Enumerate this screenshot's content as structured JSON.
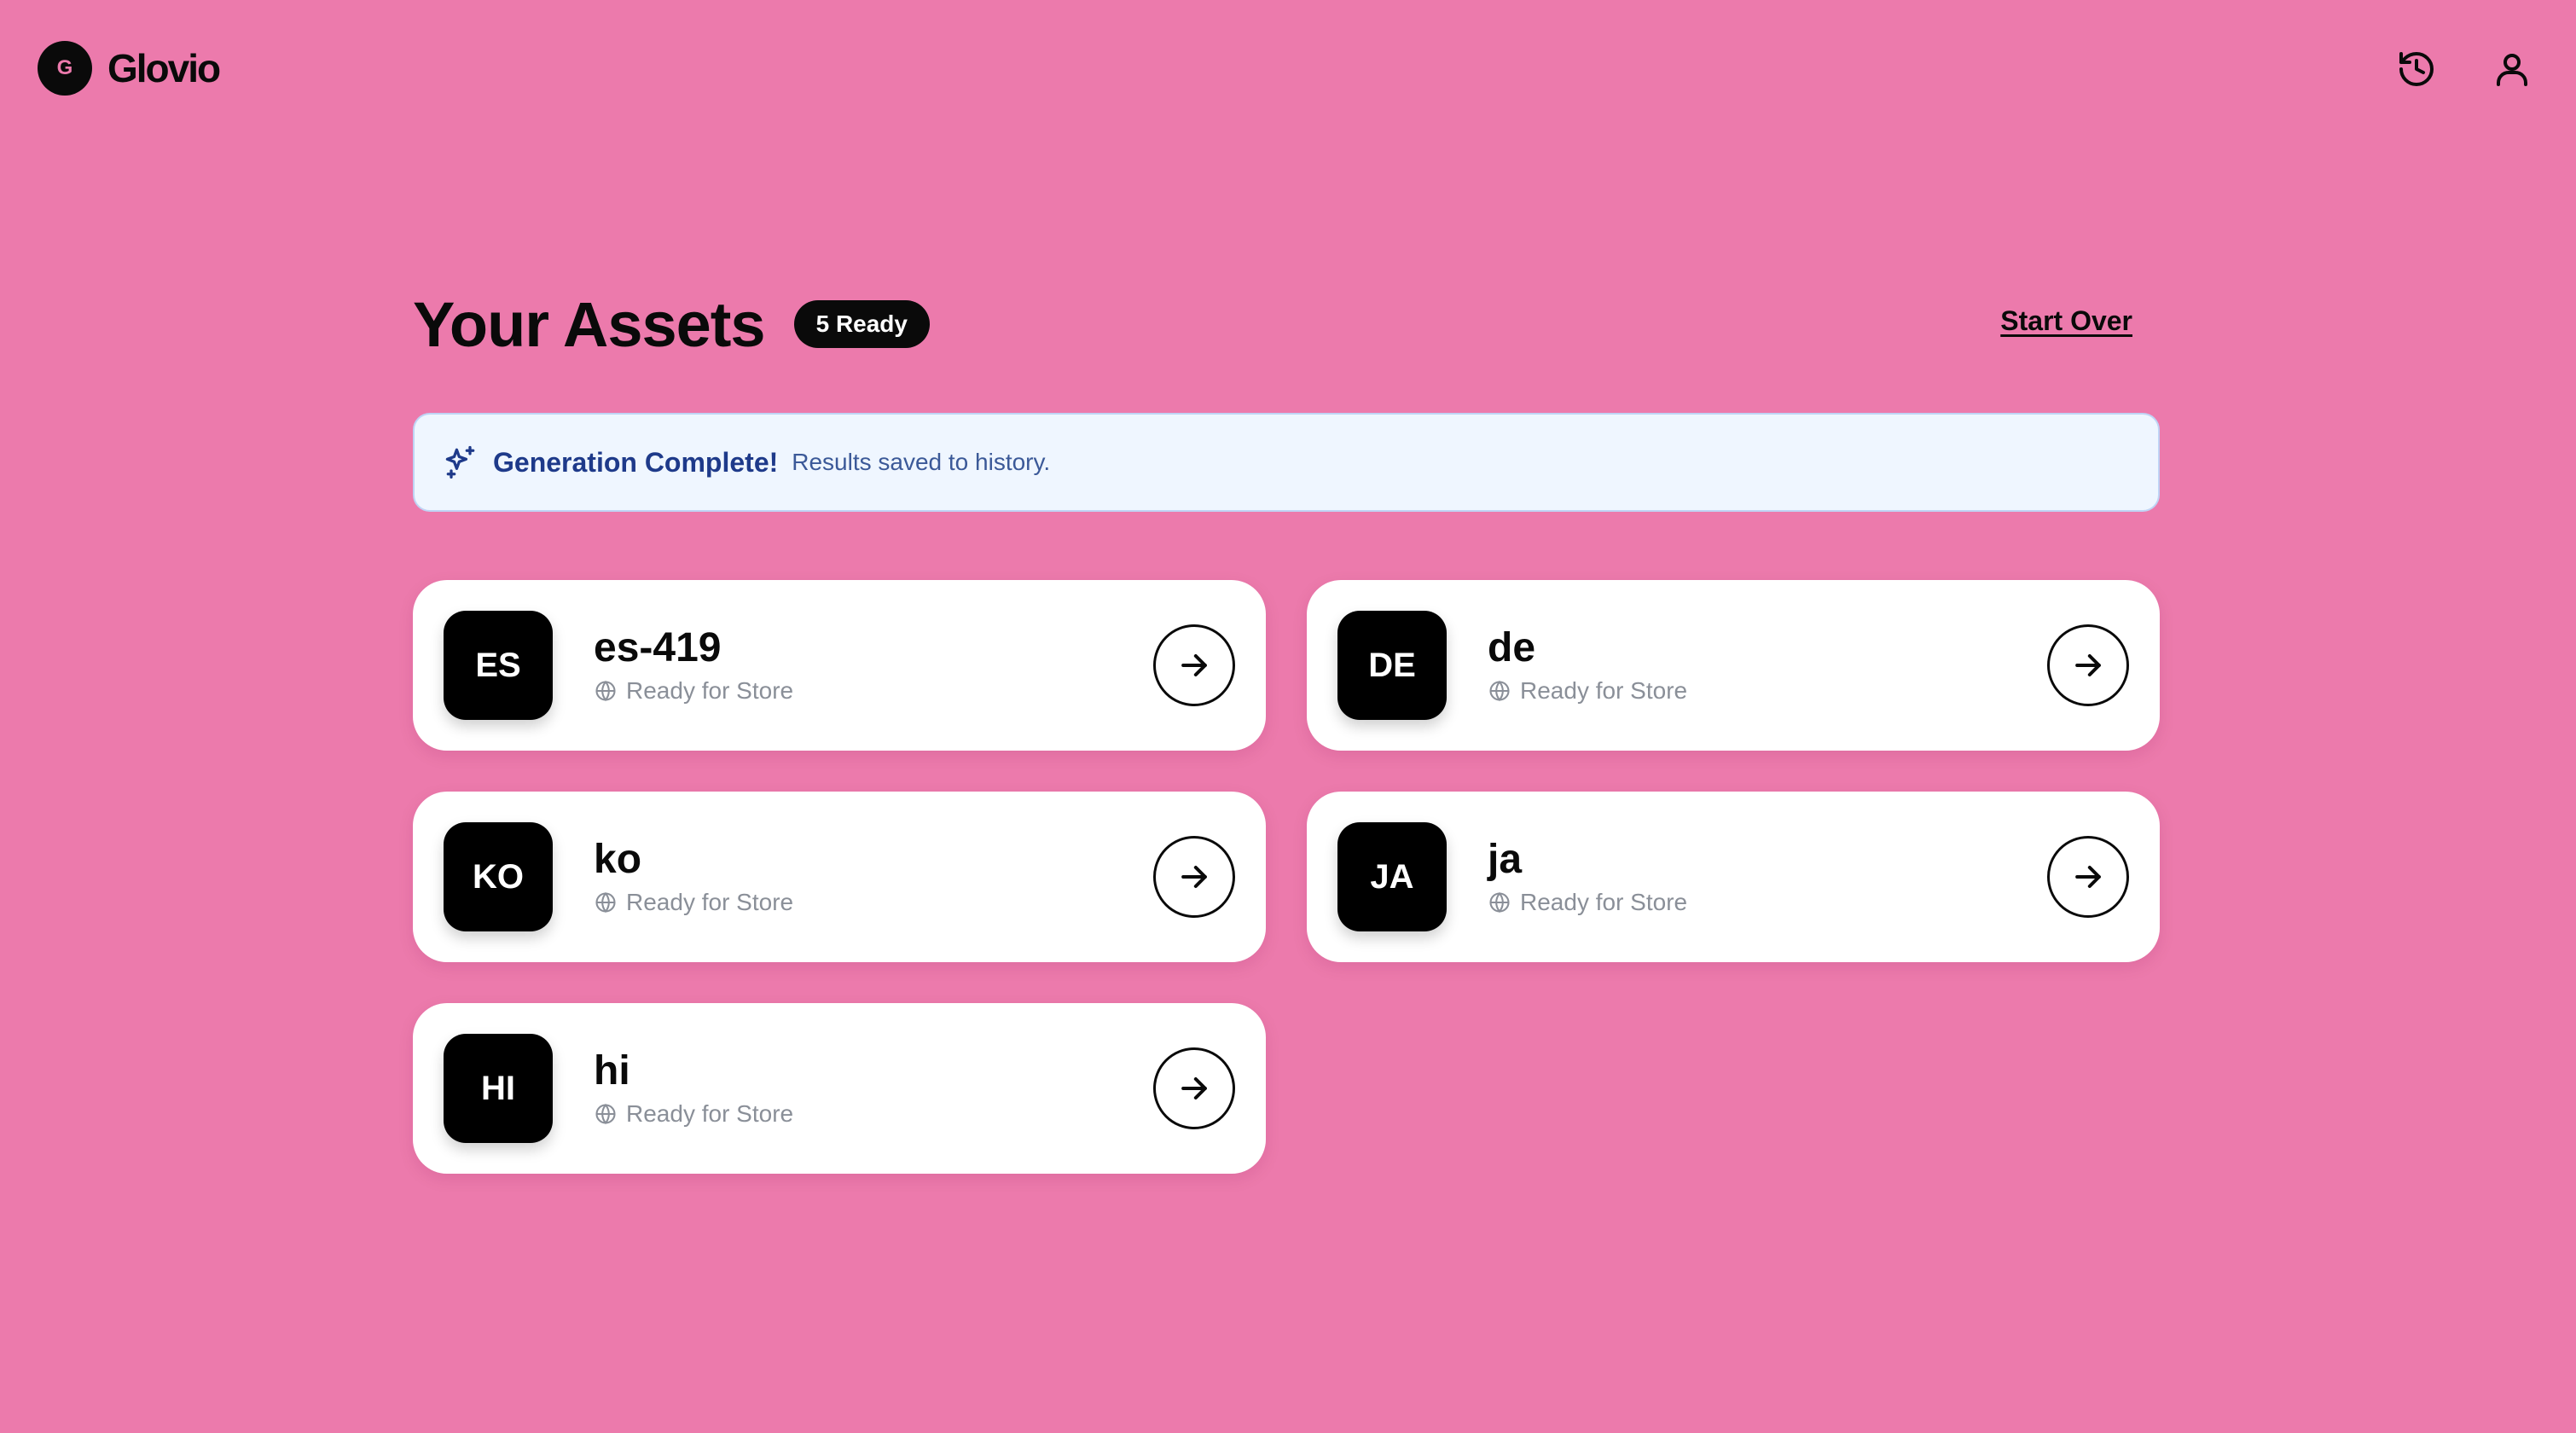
{
  "header": {
    "brand_initial": "G",
    "brand_name": "Glovio",
    "icons": [
      "history-icon",
      "user-icon"
    ]
  },
  "main": {
    "title": "Your Assets",
    "badge": "5 Ready",
    "start_over": "Start Over"
  },
  "notice": {
    "icon": "sparkles-icon",
    "title": "Generation Complete!",
    "text": "Results saved to history."
  },
  "assets": [
    {
      "initials": "ES",
      "code": "es-419",
      "status": "Ready for Store"
    },
    {
      "initials": "DE",
      "code": "de",
      "status": "Ready for Store"
    },
    {
      "initials": "KO",
      "code": "ko",
      "status": "Ready for Store"
    },
    {
      "initials": "JA",
      "code": "ja",
      "status": "Ready for Store"
    },
    {
      "initials": "HI",
      "code": "hi",
      "status": "Ready for Store"
    }
  ],
  "colors": {
    "background": "#ec7aac",
    "notice_bg": "#eff6ff",
    "notice_title": "#1e3a8a",
    "tile": "#000000",
    "card": "#ffffff"
  }
}
